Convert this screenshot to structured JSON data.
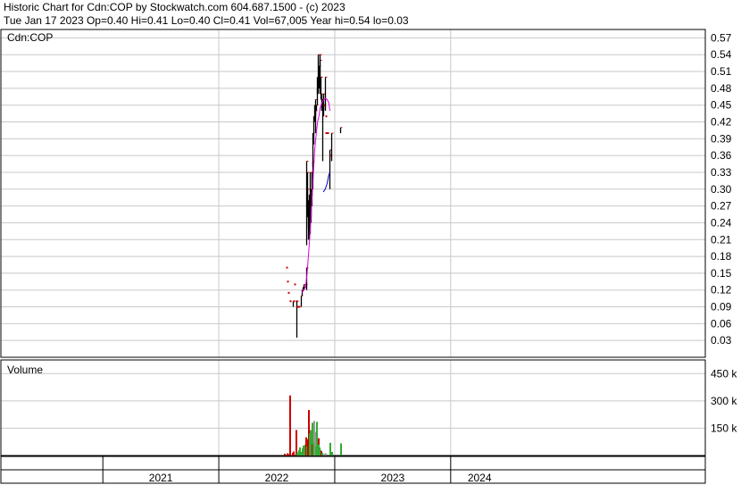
{
  "header": {
    "line1": "Historic Chart for Cdn:COP by Stockwatch.com 604.687.1500 - (c) 2023",
    "line2": "Tue Jan 17 2023  Op=0.40  Hi=0.41  Lo=0.40  Cl=0.41  Vol=67,005  Year hi=0.54  lo=0.03"
  },
  "colors": {
    "background": "#ffffff",
    "grid": "#c8c8c8",
    "frame": "#000000",
    "price_up": "#000000",
    "price_down": "#cc0000",
    "ma_long": "#e000e0",
    "ma_short": "#0000cc",
    "vol_red": "#cc0000",
    "vol_green": "#33aa33",
    "vol_gray": "#999999"
  },
  "chart_data": [
    {
      "type": "line",
      "label": "Cdn:COP",
      "y_ticks": [
        "0.57",
        "0.54",
        "0.51",
        "0.48",
        "0.45",
        "0.42",
        "0.39",
        "0.36",
        "0.33",
        "0.30",
        "0.27",
        "0.24",
        "0.21",
        "0.18",
        "0.15",
        "0.12",
        "0.09",
        "0.06",
        "0.03"
      ],
      "ylim": [
        0.0,
        0.585
      ],
      "x_labels": [
        "2021",
        "2022",
        "2023",
        "2024"
      ],
      "year_boundaries": [
        "2021-01-01",
        "2022-01-01",
        "2023-01-01",
        "2024-01-01",
        "2024-07-01"
      ],
      "x_start": "2020-02-15",
      "grid": true,
      "series": [
        {
          "kind": "ohlc_sticks",
          "bars": [
            [
              "2022-08-01",
              0.16,
              0.16
            ],
            [
              "2022-08-04",
              0.135,
              0.135
            ],
            [
              "2022-08-08",
              0.115,
              0.115
            ],
            [
              "2022-08-15",
              0.1,
              0.1
            ],
            [
              "2022-08-22",
              0.09,
              0.1
            ],
            [
              "2022-08-25",
              0.1,
              0.1
            ],
            [
              "2022-08-29",
              0.13,
              0.13
            ],
            [
              "2022-09-01",
              0.1,
              0.1
            ],
            [
              "2022-09-03",
              0.035,
              0.1
            ],
            [
              "2022-09-06",
              0.09,
              0.09
            ],
            [
              "2022-09-12",
              0.09,
              0.09
            ],
            [
              "2022-09-16",
              0.09,
              0.11
            ],
            [
              "2022-09-19",
              0.11,
              0.12
            ],
            [
              "2022-09-23",
              0.12,
              0.125
            ],
            [
              "2022-09-26",
              0.12,
              0.13
            ],
            [
              "2022-09-30",
              0.125,
              0.13
            ],
            [
              "2022-10-02",
              0.12,
              0.16
            ],
            [
              "2022-10-04",
              0.2,
              0.35
            ],
            [
              "2022-10-05",
              0.26,
              0.33
            ],
            [
              "2022-10-06",
              0.25,
              0.3
            ],
            [
              "2022-10-08",
              0.23,
              0.28
            ],
            [
              "2022-10-10",
              0.21,
              0.27
            ],
            [
              "2022-10-12",
              0.21,
              0.29
            ],
            [
              "2022-10-14",
              0.22,
              0.33
            ],
            [
              "2022-10-16",
              0.25,
              0.3
            ],
            [
              "2022-10-18",
              0.24,
              0.29
            ],
            [
              "2022-10-20",
              0.27,
              0.33
            ],
            [
              "2022-10-22",
              0.3,
              0.35
            ],
            [
              "2022-10-24",
              0.34,
              0.4
            ],
            [
              "2022-10-26",
              0.38,
              0.43
            ],
            [
              "2022-10-28",
              0.42,
              0.45
            ],
            [
              "2022-10-30",
              0.4,
              0.44
            ],
            [
              "2022-11-01",
              0.43,
              0.46
            ],
            [
              "2022-11-03",
              0.44,
              0.45
            ],
            [
              "2022-11-05",
              0.45,
              0.48
            ],
            [
              "2022-11-07",
              0.47,
              0.5
            ],
            [
              "2022-11-09",
              0.47,
              0.54
            ],
            [
              "2022-11-11",
              0.48,
              0.52
            ],
            [
              "2022-11-13",
              0.5,
              0.53
            ],
            [
              "2022-11-15",
              0.47,
              0.54
            ],
            [
              "2022-11-17",
              0.46,
              0.5
            ],
            [
              "2022-11-19",
              0.44,
              0.46
            ],
            [
              "2022-11-21",
              0.44,
              0.47
            ],
            [
              "2022-11-23",
              0.35,
              0.46
            ],
            [
              "2022-11-25",
              0.43,
              0.47
            ],
            [
              "2022-11-27",
              0.44,
              0.45
            ],
            [
              "2022-11-29",
              0.45,
              0.45
            ],
            [
              "2022-12-01",
              0.44,
              0.5
            ],
            [
              "2022-12-03",
              0.4,
              0.4
            ],
            [
              "2022-12-05",
              0.43,
              0.43
            ],
            [
              "2022-12-10",
              0.4,
              0.4
            ],
            [
              "2022-12-14",
              0.3,
              0.37
            ],
            [
              "2022-12-17",
              0.36,
              0.36
            ],
            [
              "2022-12-21",
              0.35,
              0.4
            ],
            [
              "2023-01-17",
              0.4,
              0.41
            ]
          ]
        },
        {
          "kind": "moving_average",
          "name": "",
          "color_key": "ma_long",
          "points": [
            [
              "2022-09-20",
              0.115
            ],
            [
              "2022-10-01",
              0.125
            ],
            [
              "2022-10-06",
              0.15
            ],
            [
              "2022-10-10",
              0.18
            ],
            [
              "2022-10-14",
              0.21
            ],
            [
              "2022-10-18",
              0.25
            ],
            [
              "2022-10-22",
              0.29
            ],
            [
              "2022-10-26",
              0.33
            ],
            [
              "2022-10-30",
              0.37
            ],
            [
              "2022-11-04",
              0.4
            ],
            [
              "2022-11-08",
              0.42
            ],
            [
              "2022-11-12",
              0.43
            ],
            [
              "2022-11-16",
              0.445
            ],
            [
              "2022-11-22",
              0.455
            ],
            [
              "2022-11-28",
              0.46
            ],
            [
              "2022-12-03",
              0.462
            ],
            [
              "2022-12-08",
              0.46
            ],
            [
              "2022-12-13",
              0.455
            ],
            [
              "2022-12-17",
              0.44
            ]
          ]
        },
        {
          "kind": "moving_average",
          "name": "",
          "color_key": "ma_short",
          "points": [
            [
              "2022-11-26",
              0.295
            ],
            [
              "2022-12-02",
              0.3
            ],
            [
              "2022-12-08",
              0.31
            ],
            [
              "2022-12-13",
              0.325
            ],
            [
              "2022-12-17",
              0.33
            ]
          ]
        }
      ]
    },
    {
      "type": "bar",
      "label": "Volume",
      "y_ticks": [
        "450 k",
        "300 k",
        "150 k"
      ],
      "ylim": [
        0,
        525
      ],
      "units": "k",
      "values_dated": [
        [
          "2022-07-24",
          10,
          "red"
        ],
        [
          "2022-08-01",
          12,
          "red"
        ],
        [
          "2022-08-08",
          8,
          "red"
        ],
        [
          "2022-08-12",
          330,
          "red"
        ],
        [
          "2022-08-18",
          15,
          "red"
        ],
        [
          "2022-08-23",
          22,
          "red"
        ],
        [
          "2022-08-30",
          140,
          "red"
        ],
        [
          "2022-09-03",
          18,
          "green"
        ],
        [
          "2022-09-08",
          30,
          "green"
        ],
        [
          "2022-09-12",
          45,
          "green"
        ],
        [
          "2022-09-15",
          20,
          "green"
        ],
        [
          "2022-09-18",
          40,
          "green"
        ],
        [
          "2022-09-21",
          55,
          "green"
        ],
        [
          "2022-09-24",
          30,
          "green"
        ],
        [
          "2022-09-27",
          60,
          "green"
        ],
        [
          "2022-09-30",
          100,
          "red"
        ],
        [
          "2022-10-03",
          50,
          "green"
        ],
        [
          "2022-10-05",
          75,
          "green"
        ],
        [
          "2022-10-07",
          90,
          "red"
        ],
        [
          "2022-10-09",
          250,
          "red"
        ],
        [
          "2022-10-11",
          120,
          "green"
        ],
        [
          "2022-10-13",
          60,
          "green"
        ],
        [
          "2022-10-15",
          140,
          "green"
        ],
        [
          "2022-10-17",
          90,
          "green"
        ],
        [
          "2022-10-19",
          180,
          "green"
        ],
        [
          "2022-10-21",
          60,
          "red"
        ],
        [
          "2022-10-23",
          110,
          "green"
        ],
        [
          "2022-10-25",
          190,
          "gray"
        ],
        [
          "2022-10-27",
          70,
          "green"
        ],
        [
          "2022-10-29",
          130,
          "gray"
        ],
        [
          "2022-10-31",
          50,
          "green"
        ],
        [
          "2022-11-02",
          90,
          "green"
        ],
        [
          "2022-11-04",
          185,
          "green"
        ],
        [
          "2022-11-06",
          70,
          "green"
        ],
        [
          "2022-11-08",
          95,
          "red"
        ],
        [
          "2022-11-10",
          60,
          "green"
        ],
        [
          "2022-11-12",
          45,
          "green"
        ],
        [
          "2022-11-14",
          30,
          "green"
        ],
        [
          "2022-11-17",
          25,
          "red"
        ],
        [
          "2022-11-21",
          15,
          "green"
        ],
        [
          "2022-11-25",
          10,
          "gray"
        ],
        [
          "2022-12-01",
          12,
          "gray"
        ],
        [
          "2022-12-14",
          70,
          "green"
        ],
        [
          "2022-12-20",
          20,
          "green"
        ],
        [
          "2023-01-17",
          67,
          "green"
        ]
      ]
    }
  ]
}
